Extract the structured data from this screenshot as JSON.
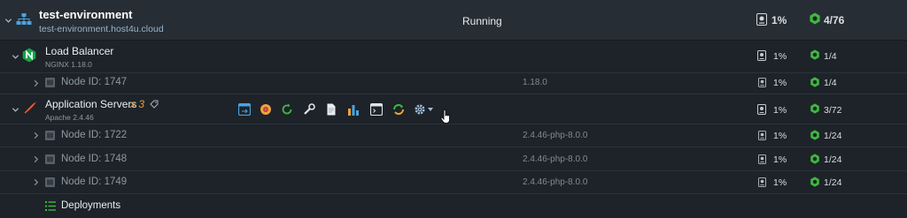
{
  "environment": {
    "name": "test-environment",
    "domain": "test-environment.host4u.cloud",
    "status": "Running",
    "disk": "1%",
    "cloudlets": "4/76"
  },
  "load_balancer": {
    "title": "Load Balancer",
    "subtitle": "NGINX 1.18.0",
    "disk": "1%",
    "cloudlets": "1/4",
    "nodes": [
      {
        "id": "Node ID: 1747",
        "version": "1.18.0",
        "disk": "1%",
        "cloudlets": "1/4"
      }
    ]
  },
  "app_servers": {
    "title": "Application Servers",
    "count": "x 3",
    "subtitle": "Apache 2.4.46",
    "disk": "1%",
    "cloudlets": "3/72",
    "nodes": [
      {
        "id": "Node ID: 1722",
        "version": "2.4.46-php-8.0.0",
        "disk": "1%",
        "cloudlets": "1/24"
      },
      {
        "id": "Node ID: 1748",
        "version": "2.4.46-php-8.0.0",
        "disk": "1%",
        "cloudlets": "1/24"
      },
      {
        "id": "Node ID: 1749",
        "version": "2.4.46-php-8.0.0",
        "disk": "1%",
        "cloudlets": "1/24"
      }
    ]
  },
  "deployments": {
    "label": "Deployments"
  },
  "colors": {
    "background": "#1d2329",
    "env_row": "#262d34",
    "accent_green": "#3fb83f",
    "nginx_green": "#16a34a",
    "count_orange": "#f29a2b"
  },
  "icons": {
    "env": "environment-topology-icon",
    "nginx": "nginx-logo-icon",
    "apache": "apache-feather-icon",
    "disk": "disk-icon",
    "cloudlet": "cloudlet-icon",
    "toolbar": [
      "open-in-browser-icon",
      "add-ons-icon",
      "restart-icon",
      "config-wrench-icon",
      "log-file-icon",
      "statistics-icon",
      "web-ssh-icon",
      "redeploy-icon",
      "settings-gear-icon"
    ]
  }
}
